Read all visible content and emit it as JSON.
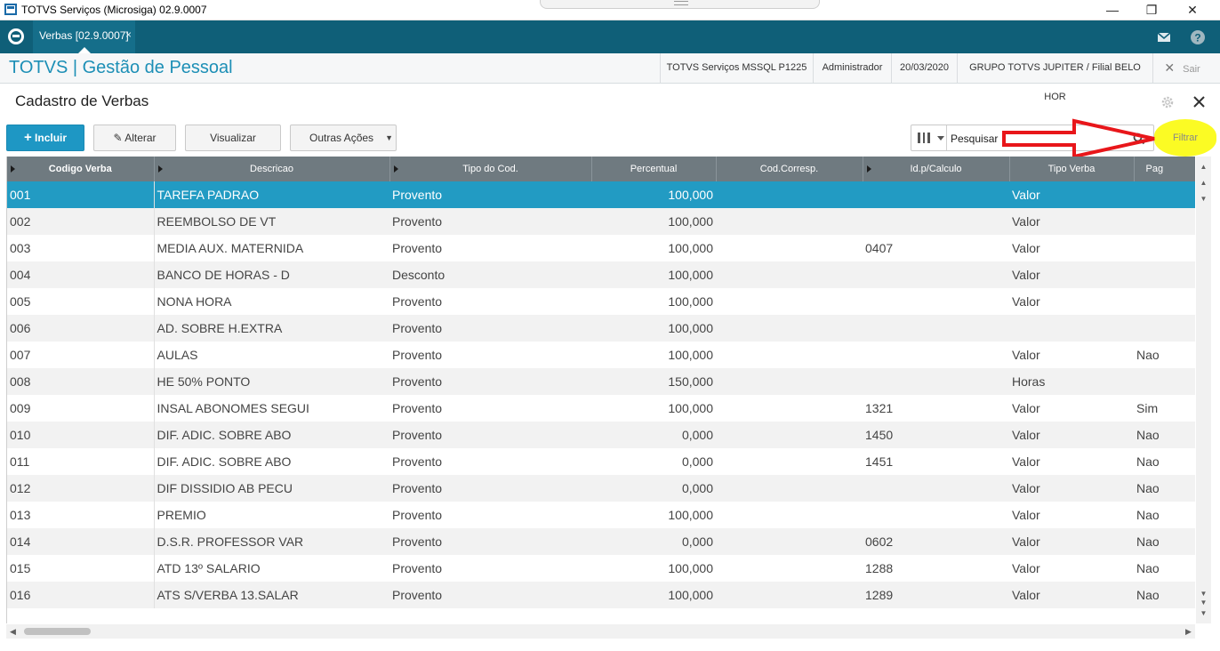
{
  "window": {
    "title": "TOTVS Serviços (Microsiga) 02.9.0007",
    "minimize": "—",
    "maximize": "❐",
    "close": "✕"
  },
  "tabbar": {
    "tab_label": "Verbas [02.9.0007]",
    "tab_close": "×"
  },
  "header": {
    "brand": "TOTVS | Gestão de Pessoal",
    "environment": "TOTVS Serviços MSSQL P1225",
    "user": "Administrador",
    "date": "20/03/2020",
    "company": "GRUPO TOTVS JUPITER / Filial BELO HOR",
    "exit_label": "Sair"
  },
  "page": {
    "title": "Cadastro de Verbas"
  },
  "toolbar": {
    "incluir": "Incluir",
    "alterar": "Alterar",
    "visualizar": "Visualizar",
    "outras_acoes": "Outras Ações",
    "search_placeholder": "Pesquisar",
    "filtrar": "Filtrar"
  },
  "colors": {
    "accent": "#1e97c4",
    "tabbar": "#0f5f78",
    "selected_row": "#229bc3",
    "highlight": "#fbfb24",
    "arrow": "#e8161a"
  },
  "grid": {
    "columns": [
      "Codigo Verba",
      "Descricao",
      "Tipo do Cod.",
      "Percentual",
      "Cod.Corresp.",
      "Id.p/Calculo",
      "Tipo Verba",
      "Pag"
    ],
    "rows": [
      [
        "001",
        "TAREFA PADRAO",
        "Provento",
        "100,000",
        "",
        "",
        "Valor",
        ""
      ],
      [
        "002",
        "REEMBOLSO DE VT",
        "Provento",
        "100,000",
        "",
        "",
        "Valor",
        ""
      ],
      [
        "003",
        "MEDIA AUX. MATERNIDA",
        "Provento",
        "100,000",
        "",
        "0407",
        "Valor",
        ""
      ],
      [
        "004",
        "BANCO DE HORAS - D",
        "Desconto",
        "100,000",
        "",
        "",
        "Valor",
        ""
      ],
      [
        "005",
        "NONA HORA",
        "Provento",
        "100,000",
        "",
        "",
        "Valor",
        ""
      ],
      [
        "006",
        "AD. SOBRE H.EXTRA",
        "Provento",
        "100,000",
        "",
        "",
        "",
        ""
      ],
      [
        "007",
        "AULAS",
        "Provento",
        "100,000",
        "",
        "",
        "Valor",
        "Nao"
      ],
      [
        "008",
        "HE 50% PONTO",
        "Provento",
        "150,000",
        "",
        "",
        "Horas",
        ""
      ],
      [
        "009",
        "INSAL ABONOMES SEGUI",
        "Provento",
        "100,000",
        "",
        "1321",
        "Valor",
        "Sim"
      ],
      [
        "010",
        "DIF. ADIC. SOBRE ABO",
        "Provento",
        "0,000",
        "",
        "1450",
        "Valor",
        "Nao"
      ],
      [
        "011",
        "DIF. ADIC. SOBRE ABO",
        "Provento",
        "0,000",
        "",
        "1451",
        "Valor",
        "Nao"
      ],
      [
        "012",
        "DIF DISSIDIO AB PECU",
        "Provento",
        "0,000",
        "",
        "",
        "Valor",
        "Nao"
      ],
      [
        "013",
        "PREMIO",
        "Provento",
        "100,000",
        "",
        "",
        "Valor",
        "Nao"
      ],
      [
        "014",
        "D.S.R. PROFESSOR VAR",
        "Provento",
        "0,000",
        "",
        "0602",
        "Valor",
        "Nao"
      ],
      [
        "015",
        "ATD 13º SALARIO",
        "Provento",
        "100,000",
        "",
        "1288",
        "Valor",
        "Nao"
      ],
      [
        "016",
        "ATS S/VERBA 13.SALAR",
        "Provento",
        "100,000",
        "",
        "1289",
        "Valor",
        "Nao"
      ]
    ]
  }
}
